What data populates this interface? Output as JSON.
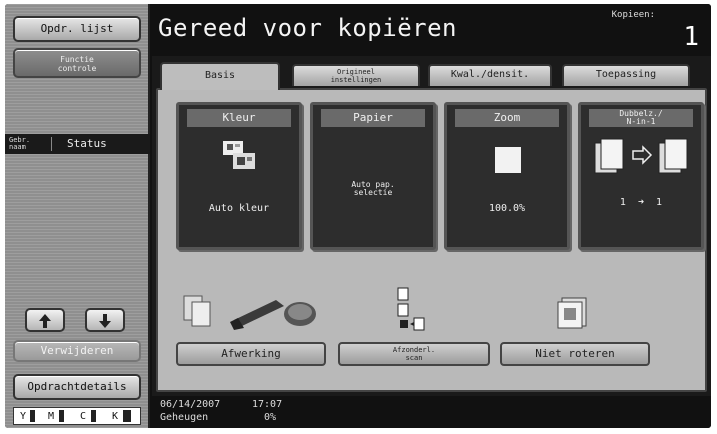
{
  "sidebar": {
    "jobs_label": "Opdr. lijst",
    "check_label_line1": "Functie",
    "check_label_line2": "controle",
    "user_label_line1": "Gebr.",
    "user_label_line2": "naam",
    "status_label": "Status",
    "delete_label": "Verwijderen",
    "details_label": "Opdrachtdetails",
    "toner": {
      "y": "Y",
      "m": "M",
      "c": "C",
      "k": "K"
    }
  },
  "header": {
    "title": "Gereed voor kopiëren",
    "copies_label": "Kopieen:",
    "copies_value": "1"
  },
  "tabs": {
    "basis": "Basis",
    "original_line1": "Origineel",
    "original_line2": "instellingen",
    "quality": "Kwal./densit.",
    "apply": "Toepassing"
  },
  "functions": {
    "color": {
      "title": "Kleur",
      "value": "Auto kleur"
    },
    "paper": {
      "title": "Papier",
      "value_line1": "Auto pap.",
      "value_line2": "selectie"
    },
    "zoom": {
      "title": "Zoom",
      "value": "100.0%"
    },
    "duplex": {
      "title_line1": "Dubbelz./",
      "title_line2": "N-in-1",
      "value_left": "1",
      "value_right": "1"
    }
  },
  "actions": {
    "finishing": "Afwerking",
    "separate_line1": "Afzonderl.",
    "separate_line2": "scan",
    "rotate": "Niet roteren"
  },
  "footer": {
    "date": "06/14/2007",
    "time": "17:07",
    "memory_label": "Geheugen",
    "memory_value": "0%"
  }
}
